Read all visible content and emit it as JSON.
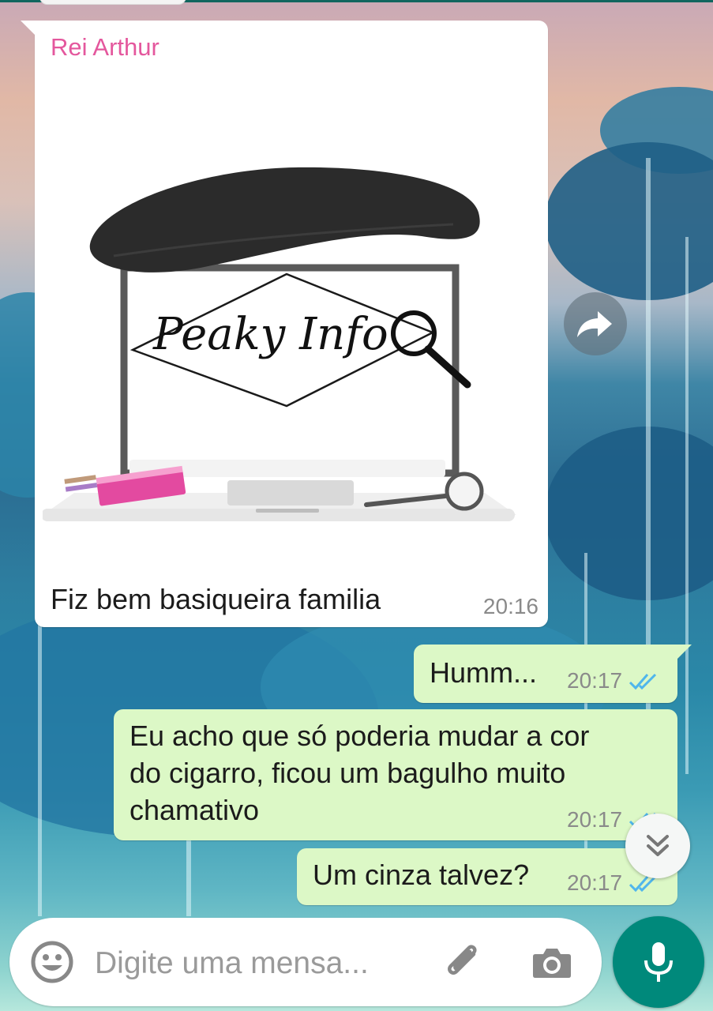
{
  "theme": {
    "incoming_bubble": "#ffffff",
    "outgoing_bubble": "#dcf8c6",
    "sender_color": "#e4579d",
    "read_tick_color": "#4fb6ec",
    "accent": "#00897b"
  },
  "incoming": {
    "sender": "Rei Arthur",
    "image_text": "Peaky Info",
    "caption": "Fiz bem basiqueira familia",
    "time": "20:16"
  },
  "outgoing": [
    {
      "text": "Humm...",
      "time": "20:17",
      "status": "read"
    },
    {
      "text_lines": [
        "Eu acho que só poderia mudar a cor",
        "do cigarro, ficou um bagulho muito",
        "chamativo"
      ],
      "time": "20:17",
      "status": "read"
    },
    {
      "text": "Um cinza talvez?",
      "time": "20:17",
      "status": "read"
    }
  ],
  "composer": {
    "placeholder": "Digite uma mensa..."
  },
  "icons": {
    "forward": "forward-icon",
    "scroll": "double-chevron-down-icon",
    "emoji": "emoji-icon",
    "attach": "paperclip-icon",
    "camera": "camera-icon",
    "mic": "microphone-icon",
    "ticks": "double-check-icon"
  }
}
